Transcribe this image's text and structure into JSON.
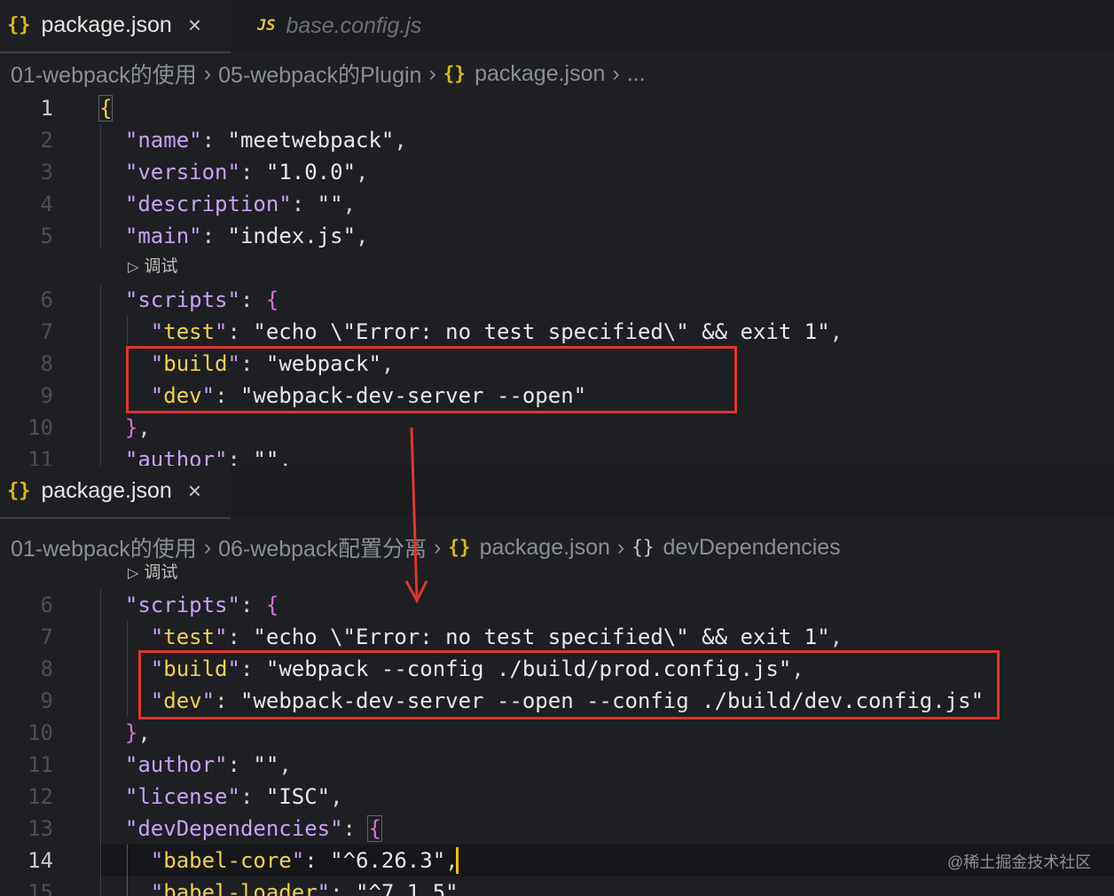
{
  "top": {
    "tabs": [
      {
        "label": "package.json",
        "icon": "{}",
        "active": true,
        "close": "×"
      },
      {
        "label": "base.config.js",
        "icon": "JS",
        "active": false
      }
    ],
    "breadcrumbs": [
      "01-webpack的使用",
      "05-webpack的Plugin",
      "package.json",
      "..."
    ],
    "codelens": "调试",
    "lines": [
      {
        "n": "1"
      },
      {
        "n": "2"
      },
      {
        "n": "3"
      },
      {
        "n": "4"
      },
      {
        "n": "5"
      },
      {
        "n": "6"
      },
      {
        "n": "7"
      },
      {
        "n": "8"
      },
      {
        "n": "9"
      },
      {
        "n": "10"
      },
      {
        "n": "11"
      }
    ],
    "values": {
      "name": "meetwebpack",
      "version": "1.0.0",
      "main": "index.js",
      "test": "echo \\\"Error: no test specified\\\" && exit 1",
      "build": "webpack",
      "dev": "webpack-dev-server --open"
    }
  },
  "bottom": {
    "tabs": [
      {
        "label": "package.json",
        "icon": "{}",
        "active": true,
        "close": "×"
      }
    ],
    "breadcrumbs": [
      "01-webpack的使用",
      "06-webpack配置分离",
      "package.json",
      "devDependencies"
    ],
    "codelens": "调试",
    "lines": [
      {
        "n": "6"
      },
      {
        "n": "7"
      },
      {
        "n": "8"
      },
      {
        "n": "9"
      },
      {
        "n": "10"
      },
      {
        "n": "11"
      },
      {
        "n": "12"
      },
      {
        "n": "13"
      },
      {
        "n": "14"
      },
      {
        "n": "15"
      }
    ],
    "values": {
      "test": "echo \\\"Error: no test specified\\\" && exit 1",
      "build": "webpack --config ./build/prod.config.js",
      "dev": "webpack-dev-server --open --config ./build/dev.config.js",
      "license": "ISC",
      "babel_core": "^6.26.3",
      "babel_loader": "^7.1.5"
    }
  },
  "watermark": "@稀土掘金技术社区",
  "colors": {
    "highlight": "#e0342d",
    "arrow": "#e0342d",
    "brace": "#f0d24a",
    "key": "#c9a0f7"
  }
}
